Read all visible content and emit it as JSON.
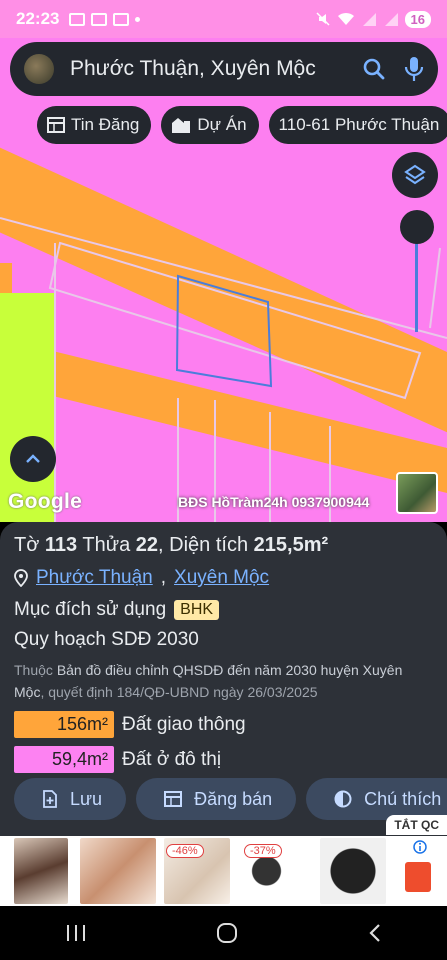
{
  "status": {
    "time": "22:23",
    "battery": "16"
  },
  "search": {
    "text": "Phước Thuận, Xuyên Mộc"
  },
  "chips": [
    {
      "label": "Tin Đăng",
      "icon": "calendar-icon"
    },
    {
      "label": "Dự Án",
      "icon": "building-icon"
    },
    {
      "label": "110-61 Phước Thuận",
      "icon": ""
    }
  ],
  "map": {
    "google": "Google",
    "watermark": "BĐS HồTràm24h 0937900944"
  },
  "parcel": {
    "to_label": "Tờ",
    "to": "113",
    "thua_label": "Thửa",
    "thua": "22",
    "area_label": ", Diện tích",
    "area": "215,5m²",
    "commune": "Phước Thuận",
    "district": "Xuyên Mộc",
    "purpose_label": "Mục đích sử dụng",
    "purpose_code": "BHK",
    "plan_title": "Quy hoạch SDĐ 2030",
    "note_prefix": "Thuộc",
    "note_map": "Bản đồ điều chỉnh QHSDĐ đến năm 2030 huyện Xuyên Mộc",
    "note_suffix": ", quyết định 184/QĐ-UBND ngày 26/03/2025",
    "areas": [
      {
        "value": "156m²",
        "label": "Đất giao thông",
        "color": "#ffa53a"
      },
      {
        "value": "59,4m²",
        "label": "Đất ở đô thị",
        "color": "#fd82f2"
      }
    ]
  },
  "actions": [
    {
      "label": "Lưu"
    },
    {
      "label": "Đăng bán"
    },
    {
      "label": "Chú thích"
    }
  ],
  "ad": {
    "close_label": "TẮT QC",
    "discounts": [
      "-46%",
      "-37%"
    ]
  },
  "colors": {
    "map_bg": "#fd7ff0",
    "road": "#ffa53a",
    "sheet": "#2d3138",
    "link": "#7ab2ff"
  }
}
